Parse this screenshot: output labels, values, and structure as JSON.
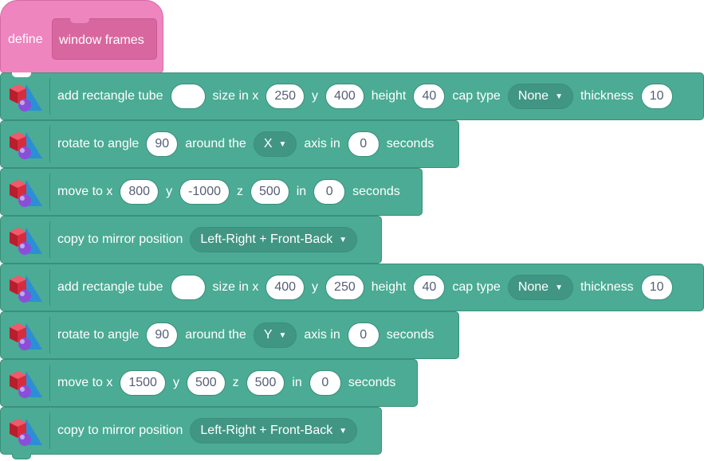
{
  "define": {
    "label": "define",
    "name": "window frames"
  },
  "blocks": [
    {
      "kind": "add-tube",
      "t1": "add rectangle tube",
      "name_value": "",
      "t2": "size in x",
      "x": "250",
      "t3": "y",
      "y": "400",
      "t4": "height",
      "height": "40",
      "t5": "cap type",
      "cap": "None",
      "t6": "thickness",
      "thickness": "10"
    },
    {
      "kind": "rotate",
      "t1": "rotate to angle",
      "angle": "90",
      "t2": "around the",
      "axis": "X",
      "t3": "axis in",
      "secs": "0",
      "t4": "seconds"
    },
    {
      "kind": "move",
      "t1": "move to x",
      "x": "800",
      "t2": "y",
      "y": "-1000",
      "t3": "z",
      "z": "500",
      "t4": "in",
      "secs": "0",
      "t5": "seconds"
    },
    {
      "kind": "mirror",
      "t1": "copy to mirror position",
      "mode": "Left-Right + Front-Back"
    },
    {
      "kind": "add-tube",
      "t1": "add rectangle tube",
      "name_value": "",
      "t2": "size in x",
      "x": "400",
      "t3": "y",
      "y": "250",
      "t4": "height",
      "height": "40",
      "t5": "cap type",
      "cap": "None",
      "t6": "thickness",
      "thickness": "10"
    },
    {
      "kind": "rotate",
      "t1": "rotate to angle",
      "angle": "90",
      "t2": "around the",
      "axis": "Y",
      "t3": "axis in",
      "secs": "0",
      "t4": "seconds"
    },
    {
      "kind": "move",
      "t1": "move to x",
      "x": "1500",
      "t2": "y",
      "y": "500",
      "t3": "z",
      "z": "500",
      "t4": "in",
      "secs": "0",
      "t5": "seconds"
    },
    {
      "kind": "mirror",
      "t1": "copy to mirror position",
      "mode": "Left-Right + Front-Back"
    }
  ],
  "colors": {
    "block": "#4bab94",
    "block_border": "#3a907b",
    "define": "#ee85be",
    "define_inner": "#d9679f"
  },
  "icons": {
    "extension": "3d-shapes-icon",
    "dropdown": "caret-down-icon"
  }
}
